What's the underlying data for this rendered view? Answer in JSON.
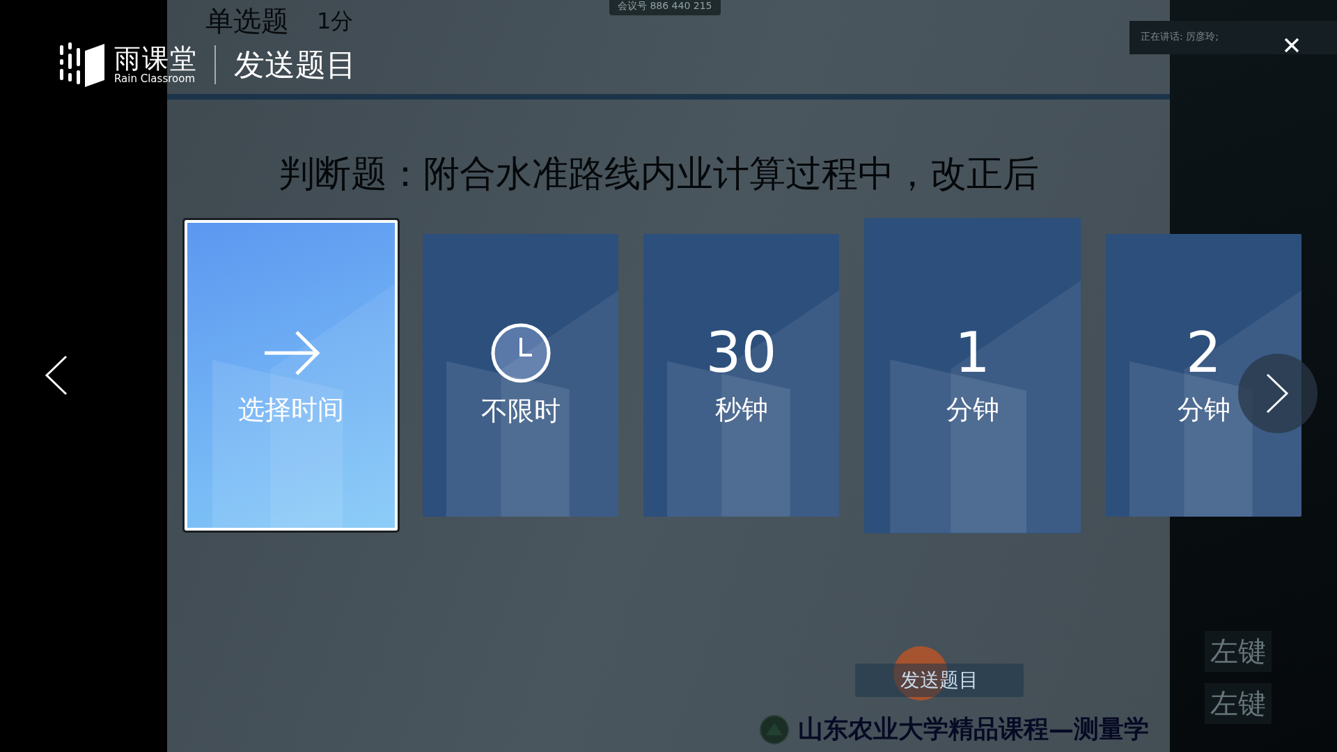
{
  "slide": {
    "type_label": "单选题",
    "score": "1分",
    "meeting": "会议号 886 440 215",
    "question_line": "判断题：附合水准路线内业计算过程中，改正后",
    "send_button": "发送题目",
    "footer": "山东农业大学精品课程—测量学"
  },
  "side_panel": {
    "speaking": "正在讲话: 厉彦玲;",
    "hints": [
      "左键",
      "左键"
    ]
  },
  "dialog": {
    "brand": "雨课堂",
    "brand_en": "Rain Classroom",
    "title": "发送题目",
    "cards": [
      {
        "kind": "choose",
        "label": "选择时间",
        "selected": true,
        "hovered": false
      },
      {
        "kind": "unlimited",
        "label": "不限时",
        "selected": false,
        "hovered": false
      },
      {
        "kind": "duration",
        "value": "30",
        "label": "秒钟",
        "selected": false,
        "hovered": false
      },
      {
        "kind": "duration",
        "value": "1",
        "label": "分钟",
        "selected": false,
        "hovered": true
      },
      {
        "kind": "duration",
        "value": "2",
        "label": "分钟",
        "selected": false,
        "hovered": false
      }
    ]
  }
}
